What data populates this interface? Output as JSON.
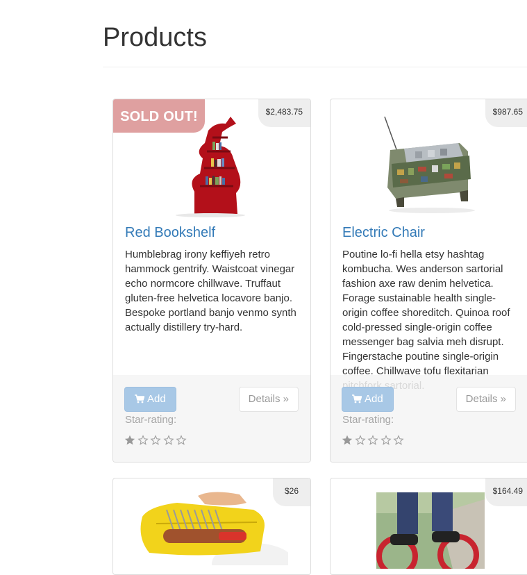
{
  "page": {
    "title": "Products"
  },
  "colors": {
    "link": "#337ab7",
    "sold_out_ribbon": "#dfa0a0",
    "add_button": "#a8c8e6",
    "price_tag_bg": "#eeeeee"
  },
  "products": [
    {
      "name": "Red Bookshelf",
      "price": "$2,483.75",
      "sold_out_label": "SOLD OUT!",
      "description": "Humblebrag irony keffiyeh retro hammock gentrify. Waistcoat vinegar echo normcore chillwave. Truffaut gluten-free helvetica locavore banjo. Bespoke portland banjo venmo synth actually distillery try-hard.",
      "add_label": "Add",
      "details_label": "Details »",
      "rating_label": "Star-rating:",
      "rating": 1,
      "rating_max": 5
    },
    {
      "name": "Electric Chair",
      "price": "$987.65",
      "description": "Poutine lo-fi hella etsy hashtag kombucha. Wes anderson sartorial fashion axe raw denim helvetica. Forage sustainable health single-origin coffee shoreditch. Quinoa roof cold-pressed single-origin coffee messenger bag salvia meh disrupt. Fingerstache poutine single-origin coffee. Chillwave tofu flexitarian pitchfork sartorial.",
      "add_label": "Add",
      "details_label": "Details »",
      "rating_label": "Star-rating:",
      "rating": 1,
      "rating_max": 5
    },
    {
      "price": "$26"
    },
    {
      "price": "$164.49"
    }
  ],
  "icons": {
    "cart": "shopping-cart-icon",
    "star_filled": "star-filled-icon",
    "star_empty": "star-empty-icon"
  }
}
